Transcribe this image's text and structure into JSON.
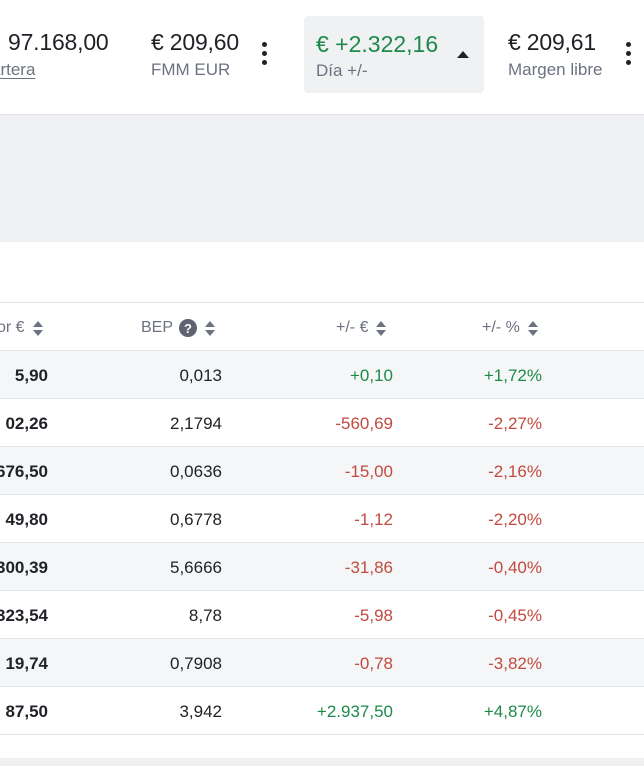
{
  "summary": {
    "portfolio": {
      "value": "97.168,00",
      "label": "artera"
    },
    "fmm": {
      "value": "€ 209,60",
      "label": "FMM EUR"
    },
    "day": {
      "value": "€ +2.322,16",
      "label": "Día +/-"
    },
    "margin": {
      "value": "€ 209,61",
      "label": "Margen libre"
    }
  },
  "colors": {
    "positive": "#1d8a4a",
    "negative": "#c24a40",
    "muted": "#6c7280"
  },
  "table": {
    "headers": {
      "value": "or €",
      "bep": "BEP",
      "help": "?",
      "change": "+/- €",
      "change_pct": "+/- %"
    },
    "rows": [
      {
        "value": "5,90",
        "bep": "0,013",
        "change": "+0,10",
        "pct": "+1,72%",
        "dir": "pos"
      },
      {
        "value": "02,26",
        "bep": "2,1794",
        "change": "-560,69",
        "pct": "-2,27%",
        "dir": "neg"
      },
      {
        "value": "676,50",
        "bep": "0,0636",
        "change": "-15,00",
        "pct": "-2,16%",
        "dir": "neg"
      },
      {
        "value": "49,80",
        "bep": "0,6778",
        "change": "-1,12",
        "pct": "-2,20%",
        "dir": "neg"
      },
      {
        "value": "300,39",
        "bep": "5,6666",
        "change": "-31,86",
        "pct": "-0,40%",
        "dir": "neg"
      },
      {
        "value": "323,54",
        "bep": "8,78",
        "change": "-5,98",
        "pct": "-0,45%",
        "dir": "neg"
      },
      {
        "value": "19,74",
        "bep": "0,7908",
        "change": "-0,78",
        "pct": "-3,82%",
        "dir": "neg"
      },
      {
        "value": "87,50",
        "bep": "3,942",
        "change": "+2.937,50",
        "pct": "+4,87%",
        "dir": "pos"
      }
    ]
  }
}
